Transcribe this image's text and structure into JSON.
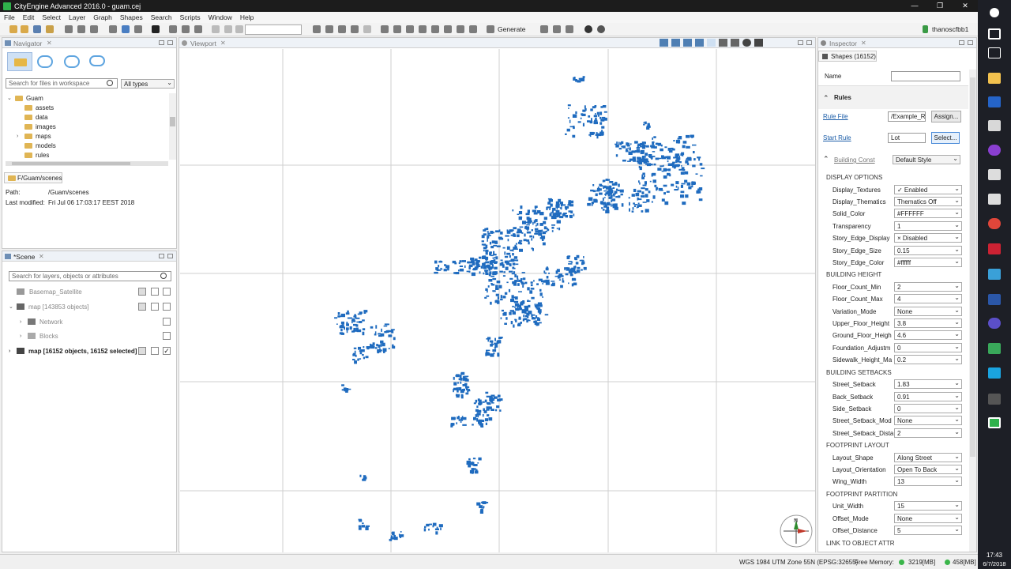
{
  "window": {
    "title": "CityEngine Advanced 2016.0 - guam.cej",
    "controls": [
      "—",
      "❐",
      "✕"
    ]
  },
  "menu": [
    "File",
    "Edit",
    "Select",
    "Layer",
    "Graph",
    "Shapes",
    "Search",
    "Scripts",
    "Window",
    "Help"
  ],
  "toolbar": {
    "generate_label": "Generate",
    "user": "thanoscfbb1"
  },
  "navigator": {
    "tab": "Navigator",
    "search_placeholder": "Search for files in workspace",
    "type_filter": "All types",
    "root": "Guam",
    "folders": [
      "assets",
      "data",
      "images",
      "maps",
      "models",
      "rules"
    ],
    "path_tab": "F/Guam/scenes",
    "path_label": "Path:",
    "path_value": "/Guam/scenes",
    "modified_label": "Last modified:",
    "modified_value": "Fri Jul 06 17:03:17 EEST 2018"
  },
  "scene": {
    "tab": "*Scene",
    "search_placeholder": "Search for layers, objects or attributes",
    "layers": [
      {
        "name": "Basemap_Satellite"
      },
      {
        "name": "map [143853 objects]"
      },
      {
        "name": "Network"
      },
      {
        "name": "Blocks"
      },
      {
        "name": "map [16152 objects, 16152 selected]"
      }
    ]
  },
  "viewport": {
    "tab": "Viewport"
  },
  "inspector": {
    "tab": "Inspector",
    "subtab": "Shapes (16152)",
    "name_label": "Name",
    "rules_header": "Rules",
    "rule_file_label": "Rule File",
    "rule_file_value": "/Example_Re",
    "assign_button": "Assign...",
    "start_rule_label": "Start Rule",
    "start_rule_value": "Lot",
    "select_button": "Select...",
    "building_label": "Building Const",
    "style_value": "Default Style",
    "sections": [
      {
        "title": "DISPLAY OPTIONS",
        "props": [
          {
            "label": "Display_Textures",
            "value": "✓ Enabled"
          },
          {
            "label": "Display_Thematics",
            "value": "Thematics Off"
          },
          {
            "label": "Solid_Color",
            "value": "#FFFFFF"
          },
          {
            "label": "Transparency",
            "value": "1"
          },
          {
            "label": "Story_Edge_Display",
            "value": "× Disabled"
          },
          {
            "label": "Story_Edge_Size",
            "value": "0.15"
          },
          {
            "label": "Story_Edge_Color",
            "value": "#ffffff"
          }
        ]
      },
      {
        "title": "BUILDING HEIGHT",
        "props": [
          {
            "label": "Floor_Count_Min",
            "value": "2"
          },
          {
            "label": "Floor_Count_Max",
            "value": "4"
          },
          {
            "label": "Variation_Mode",
            "value": "None"
          },
          {
            "label": "Upper_Floor_Height",
            "value": "3.8"
          },
          {
            "label": "Ground_Floor_Heigh",
            "value": "4.6"
          },
          {
            "label": "Foundation_Adjustm",
            "value": "0"
          },
          {
            "label": "Sidewalk_Height_Ma",
            "value": "0.2"
          }
        ]
      },
      {
        "title": "BUILDING SETBACKS",
        "props": [
          {
            "label": "Street_Setback",
            "value": "1.83"
          },
          {
            "label": "Back_Setback",
            "value": "0.91"
          },
          {
            "label": "Side_Setback",
            "value": "0"
          },
          {
            "label": "Street_Setback_Mod",
            "value": "None"
          },
          {
            "label": "Street_Setback_Dista",
            "value": "2"
          }
        ]
      },
      {
        "title": "FOOTPRINT LAYOUT",
        "props": [
          {
            "label": "Layout_Shape",
            "value": "Along Street"
          },
          {
            "label": "Layout_Orientation",
            "value": "Open To Back"
          },
          {
            "label": "Wing_Width",
            "value": "13"
          }
        ]
      },
      {
        "title": "FOOTPRINT PARTITION",
        "props": [
          {
            "label": "Unit_Width",
            "value": "15"
          },
          {
            "label": "Offset_Mode",
            "value": "None"
          },
          {
            "label": "Offset_Distance",
            "value": "5"
          }
        ]
      },
      {
        "title": "LINK TO OBJECT ATTR",
        "props": []
      }
    ]
  },
  "status": {
    "crs": "WGS 1984 UTM Zone 55N (EPSG:32655)",
    "free_memory_label": "Free Memory:",
    "free_memory": "3219[MB]",
    "memory_total": "458[MB]"
  },
  "taskbar": {
    "time": "17:43",
    "date": "6/7/2018"
  },
  "colors": {
    "shape_fill": "#1f6bbf",
    "title_bg": "#1c1c1c",
    "taskbar_bg": "#1d1f26"
  }
}
